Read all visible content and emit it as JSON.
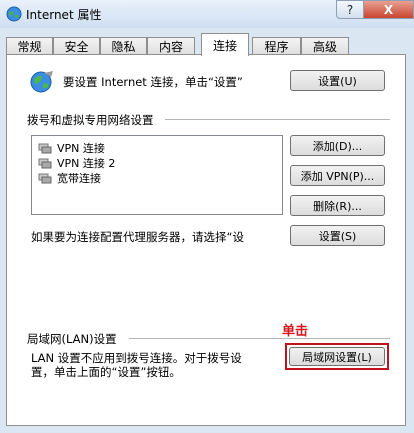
{
  "window": {
    "title": "Internet 属性",
    "help_label": "?",
    "close_label": "X"
  },
  "tabs": [
    {
      "label": "常规"
    },
    {
      "label": "安全"
    },
    {
      "label": "隐私"
    },
    {
      "label": "内容"
    },
    {
      "label": "连接",
      "active": true
    },
    {
      "label": "程序"
    },
    {
      "label": "高级"
    }
  ],
  "setup": {
    "text": "要设置 Internet 连接，单击“设置”",
    "button": "设置(U)"
  },
  "dialup": {
    "heading": "拨号和虚拟专用网络设置",
    "connections": [
      "VPN 连接",
      "VPN 连接 2",
      "宽带连接"
    ],
    "add_button": "添加(D)...",
    "add_vpn_button": "添加 VPN(P)...",
    "remove_button": "删除(R)...",
    "proxy_text": "如果要为连接配置代理服务器，请选择“设",
    "settings_button": "设置(S)"
  },
  "lan": {
    "heading": "局域网(LAN)设置",
    "description_line1": "LAN 设置不应用到拨号连接。对于拨号设",
    "description_line2": "置，单击上面的“设置”按钮。",
    "button": "局域网设置(L)"
  },
  "annotation": {
    "text": "单击",
    "color": "#d6141a"
  }
}
